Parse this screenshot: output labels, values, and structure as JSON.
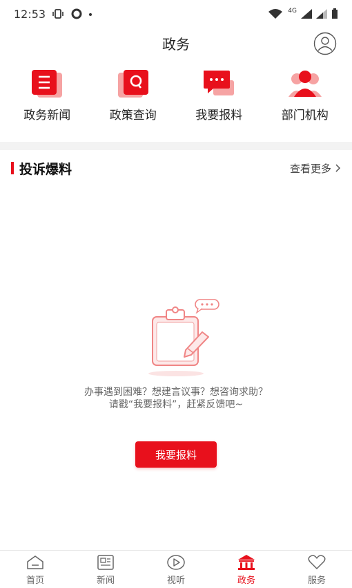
{
  "status": {
    "time": "12:53",
    "network_label": "4G"
  },
  "header": {
    "title": "政务"
  },
  "quick_nav": [
    {
      "label": "政务新闻",
      "icon": "news-list-icon"
    },
    {
      "label": "政策查询",
      "icon": "policy-search-icon"
    },
    {
      "label": "我要报料",
      "icon": "chat-report-icon"
    },
    {
      "label": "部门机构",
      "icon": "department-people-icon"
    }
  ],
  "section": {
    "title": "投诉爆料",
    "more_label": "查看更多"
  },
  "empty_state": {
    "line1": "办事遇到困难？想建言议事？想咨询求助？",
    "line2": "请戳“我要报料”，赶紧反馈吧~"
  },
  "report_button": {
    "label": "我要报料"
  },
  "tabs": [
    {
      "label": "首页",
      "icon": "home-icon",
      "active": false
    },
    {
      "label": "新闻",
      "icon": "newspaper-icon",
      "active": false
    },
    {
      "label": "视听",
      "icon": "play-icon",
      "active": false
    },
    {
      "label": "政务",
      "icon": "government-building-icon",
      "active": true
    },
    {
      "label": "服务",
      "icon": "heart-icon",
      "active": false
    }
  ],
  "colors": {
    "accent": "#e8101c",
    "icon_light": "#f6a3a3",
    "text": "#222222"
  }
}
